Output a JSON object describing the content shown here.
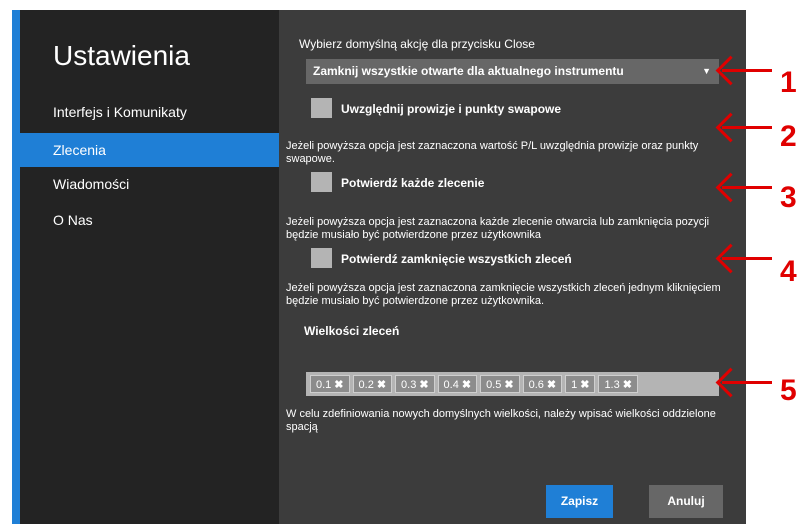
{
  "sidebar": {
    "title": "Ustawienia",
    "items": [
      {
        "label": "Interfejs i Komunikaty",
        "active": false
      },
      {
        "label": "Zlecenia",
        "active": true
      },
      {
        "label": "Wiadomości",
        "active": false
      },
      {
        "label": "O Nas",
        "active": false
      }
    ]
  },
  "main": {
    "close_action_label": "Wybierz domyślną akcję dla przycisku Close",
    "close_action_value": "Zamknij wszystkie otwarte dla aktualnego instrumentu",
    "options": [
      {
        "label": "Uwzględnij prowizje i punkty swapowe",
        "checked": false,
        "description": "Jeżeli powyższa opcja jest zaznaczona wartość P/L uwzględnia prowizje oraz punkty swapowe."
      },
      {
        "label": "Potwierdź każde zlecenie",
        "checked": false,
        "description": "Jeżeli powyższa opcja jest zaznaczona każde zlecenie otwarcia lub zamknięcia pozycji będzie musiało być potwierdzone przez użytkownika"
      },
      {
        "label": "Potwierdź zamknięcie wszystkich zleceń",
        "checked": false,
        "description": "Jeżeli powyższa opcja jest zaznaczona zamknięcie wszystkich zleceń jednym kliknięciem będzie musiało być potwierdzone przez użytkownika."
      }
    ],
    "order_sizes_label": "Wielkości zleceń",
    "order_sizes": [
      "0.1",
      "0.2",
      "0.3",
      "0.4",
      "0.5",
      "0.6",
      "1",
      "1.3"
    ],
    "remove_glyph": "✖",
    "order_sizes_hint": "W celu zdefiniowania nowych domyślnych wielkości, należy wpisać wielkości oddzielone spacją",
    "save_label": "Zapisz",
    "cancel_label": "Anuluj"
  },
  "annotations": [
    "1",
    "2",
    "3",
    "4",
    "5"
  ],
  "colors": {
    "accent": "#1f7fd6",
    "annotation": "#e00000",
    "panel": "#3c3c3c",
    "sidebar": "#232323"
  }
}
